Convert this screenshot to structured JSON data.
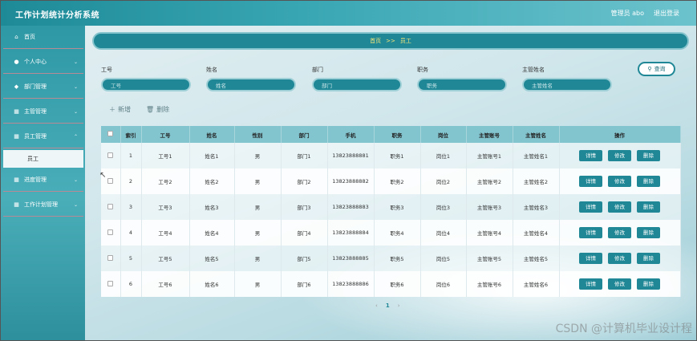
{
  "app_title": "工作计划统计分析系统",
  "header": {
    "user_label": "管理员 abo",
    "logout_label": "退出登录"
  },
  "sidebar": {
    "items": [
      {
        "label": "首页",
        "icon": "home-icon",
        "glyph": "⌂"
      },
      {
        "label": "个人中心",
        "icon": "user-icon",
        "glyph": "●"
      },
      {
        "label": "部门管理",
        "icon": "pin-icon",
        "glyph": "◆"
      },
      {
        "label": "主管管理",
        "icon": "grid-icon",
        "glyph": "▦"
      },
      {
        "label": "员工管理",
        "icon": "grid-icon",
        "glyph": "▦"
      },
      {
        "label": "进度管理",
        "icon": "grid-icon",
        "glyph": "▦"
      },
      {
        "label": "工作计划管理",
        "icon": "grid-icon",
        "glyph": "▦"
      }
    ],
    "submenu": {
      "label": "员工"
    }
  },
  "breadcrumb": {
    "home": "首页",
    "sep": ">>",
    "current": "员工"
  },
  "search": {
    "fields": [
      {
        "label": "工号",
        "placeholder": "工号"
      },
      {
        "label": "姓名",
        "placeholder": "姓名"
      },
      {
        "label": "部门",
        "placeholder": "部门"
      },
      {
        "label": "职务",
        "placeholder": "职务"
      },
      {
        "label": "主管姓名",
        "placeholder": "主管姓名"
      }
    ],
    "button": "查询"
  },
  "actions": {
    "add": "新增",
    "delete": "删除"
  },
  "table": {
    "headers": [
      "",
      "索引",
      "工号",
      "姓名",
      "性别",
      "部门",
      "手机",
      "职务",
      "岗位",
      "主管账号",
      "主管姓名",
      "操作"
    ],
    "rows": [
      [
        "1",
        "工号1",
        "姓名1",
        "男",
        "部门1",
        "13823888881",
        "职务1",
        "岗位1",
        "主管账号1",
        "主管姓名1"
      ],
      [
        "2",
        "工号2",
        "姓名2",
        "男",
        "部门2",
        "13823888882",
        "职务2",
        "岗位2",
        "主管账号2",
        "主管姓名2"
      ],
      [
        "3",
        "工号3",
        "姓名3",
        "男",
        "部门3",
        "13823888883",
        "职务3",
        "岗位3",
        "主管账号3",
        "主管姓名3"
      ],
      [
        "4",
        "工号4",
        "姓名4",
        "男",
        "部门4",
        "13823888884",
        "职务4",
        "岗位4",
        "主管账号4",
        "主管姓名4"
      ],
      [
        "5",
        "工号5",
        "姓名5",
        "男",
        "部门5",
        "13823888885",
        "职务5",
        "岗位5",
        "主管账号5",
        "主管姓名5"
      ],
      [
        "6",
        "工号6",
        "姓名6",
        "男",
        "部门6",
        "13823888886",
        "职务6",
        "岗位6",
        "主管账号6",
        "主管姓名6"
      ]
    ],
    "row_actions": [
      "详情",
      "修改",
      "删除"
    ]
  },
  "pager": {
    "prev": "‹",
    "current": "1",
    "next": "›"
  },
  "watermark": "CSDN @计算机毕业设计程",
  "colors": {
    "accent": "#1f8795",
    "header": "#3aa7b4",
    "breadcrumb_text": "#f6e67a"
  }
}
